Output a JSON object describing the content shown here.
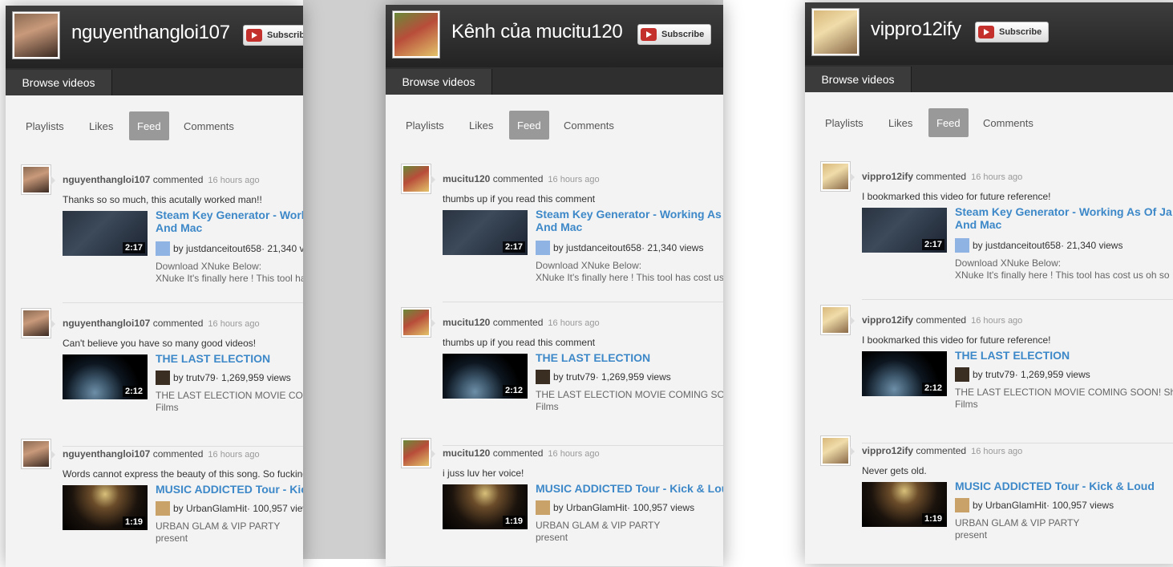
{
  "panels": [
    {
      "channel_title": "nguyenthangloi107",
      "subscribe_label": "Subscribe",
      "browse_label": "Browse videos",
      "tabs": [
        "Playlists",
        "Likes",
        "Feed",
        "Comments"
      ],
      "entries": [
        {
          "user": "nguyenthangloi107",
          "verb": "commented",
          "time": "16 hours ago",
          "comment": "Thanks so so much, this acutally worked man!!",
          "video_title": [
            "Steam Key Generator - Working As Of Ja",
            "And Mac"
          ],
          "by": "by justdanceitout658",
          "views": "· 21,340 views",
          "duration": "2:17",
          "desc": [
            "Download XNuke Below:",
            "XNuke It's finally here ! This tool has cost us oh so"
          ]
        },
        {
          "user": "nguyenthangloi107",
          "verb": "commented",
          "time": "16 hours ago",
          "comment": "Can't believe you have so many good videos!",
          "video_title": [
            "THE LAST ELECTION"
          ],
          "by": "by trutv79",
          "views": "· 1,269,959 views",
          "duration": "2:12",
          "desc": [
            "THE LAST ELECTION MOVIE COMING SOON! Sh",
            "Films"
          ]
        },
        {
          "user": "nguyenthangloi107",
          "verb": "commented",
          "time": "16 hours ago",
          "comment": "Words cannot express the beauty of this song. So fucking",
          "video_title": [
            "MUSIC ADDICTED Tour - Kick & Loud"
          ],
          "by": "by UrbanGlamHit",
          "views": "· 100,957 views",
          "duration": "1:19",
          "desc": [
            "URBAN GLAM & VIP PARTY",
            "present"
          ]
        }
      ]
    },
    {
      "channel_title": "Kênh của mucitu120",
      "subscribe_label": "Subscribe",
      "browse_label": "Browse videos",
      "tabs": [
        "Playlists",
        "Likes",
        "Feed",
        "Comments"
      ],
      "entries": [
        {
          "user": "mucitu120",
          "verb": "commented",
          "time": "16 hours ago",
          "comment": "thumbs up if you read this comment",
          "video_title": [
            "Steam Key Generator - Working As Of Ja",
            "And Mac"
          ],
          "by": "by justdanceitout658",
          "views": "· 21,340 views",
          "duration": "2:17",
          "desc": [
            "Download XNuke Below:",
            "XNuke It's finally here ! This tool has cost us oh so"
          ]
        },
        {
          "user": "mucitu120",
          "verb": "commented",
          "time": "16 hours ago",
          "comment": "thumbs up if you read this comment",
          "video_title": [
            "THE LAST ELECTION"
          ],
          "by": "by trutv79",
          "views": "· 1,269,959 views",
          "duration": "2:12",
          "desc": [
            "THE LAST ELECTION MOVIE COMING SOON! Sh",
            "Films"
          ]
        },
        {
          "user": "mucitu120",
          "verb": "commented",
          "time": "16 hours ago",
          "comment": "i juss luv her voice!",
          "video_title": [
            "MUSIC ADDICTED Tour - Kick & Loud"
          ],
          "by": "by UrbanGlamHit",
          "views": "· 100,957 views",
          "duration": "1:19",
          "desc": [
            "URBAN GLAM & VIP PARTY",
            "present"
          ]
        }
      ]
    },
    {
      "channel_title": "vippro12ify",
      "subscribe_label": "Subscribe",
      "browse_label": "Browse videos",
      "tabs": [
        "Playlists",
        "Likes",
        "Feed",
        "Comments"
      ],
      "entries": [
        {
          "user": "vippro12ify",
          "verb": "commented",
          "time": "16 hours ago",
          "comment": "I bookmarked this video for future reference!",
          "video_title": [
            "Steam Key Generator - Working As Of Ja",
            "And Mac"
          ],
          "by": "by justdanceitout658",
          "views": "· 21,340 views",
          "duration": "2:17",
          "desc": [
            "Download XNuke Below:",
            "XNuke It's finally here ! This tool has cost us oh so"
          ]
        },
        {
          "user": "vippro12ify",
          "verb": "commented",
          "time": "16 hours ago",
          "comment": "I bookmarked this video for future reference!",
          "video_title": [
            "THE LAST ELECTION"
          ],
          "by": "by trutv79",
          "views": "· 1,269,959 views",
          "duration": "2:12",
          "desc": [
            "THE LAST ELECTION MOVIE COMING SOON! Sh",
            "Films"
          ]
        },
        {
          "user": "vippro12ify",
          "verb": "commented",
          "time": "16 hours ago",
          "comment": "Never gets old.",
          "video_title": [
            "MUSIC ADDICTED Tour - Kick & Loud"
          ],
          "by": "by UrbanGlamHit",
          "views": "· 100,957 views",
          "duration": "1:19",
          "desc": [
            "URBAN GLAM & VIP PARTY",
            "present"
          ]
        }
      ]
    }
  ]
}
